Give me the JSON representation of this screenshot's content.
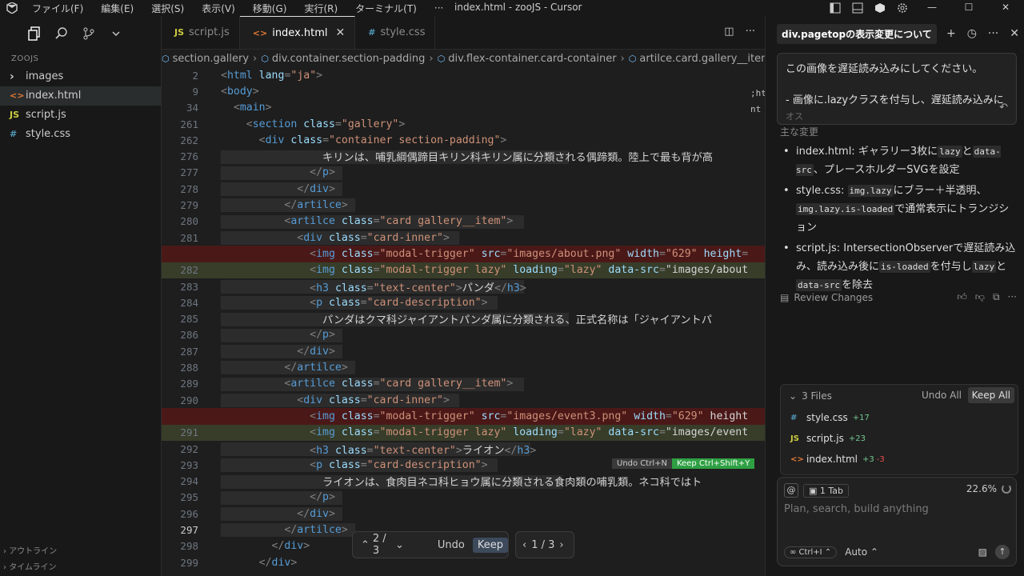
{
  "menu": [
    "ファイル(F)",
    "編集(E)",
    "選択(S)",
    "表示(V)",
    "移動(G)",
    "実行(R)",
    "ターミナル(T)",
    "···"
  ],
  "window_title": "index.html - zooJS - Cursor",
  "window_controls": {
    "minimize": "—",
    "maximize": "☐",
    "close": "✕"
  },
  "explorer": {
    "project": "ZOOJS",
    "items": [
      {
        "icon": "›",
        "label": "images"
      },
      {
        "icon": "<>",
        "label": "index.html"
      },
      {
        "icon": "JS",
        "label": "script.js"
      },
      {
        "icon": "#",
        "label": "style.css"
      }
    ],
    "outline": "アウトライン",
    "timeline": "タイムライン"
  },
  "tabs": [
    {
      "icon": "JS",
      "label": "script.js"
    },
    {
      "icon": "<>",
      "label": "index.html",
      "close": "✕"
    },
    {
      "icon": "#",
      "label": "style.css"
    }
  ],
  "breadcrumb": [
    "section.gallery",
    "div.container.section-padding",
    "div.flex-container.card-container",
    "artilce.card.gallery__item"
  ],
  "code_lines": [
    {
      "n": "2",
      "t": "<html lang=\"ja\">"
    },
    {
      "n": "9",
      "t": "<body>"
    },
    {
      "n": "34",
      "t": "  <main>"
    },
    {
      "n": "261",
      "t": "    <section class=\"gallery\">"
    },
    {
      "n": "262",
      "t": "      <div class=\"container section-padding\">"
    },
    {
      "n": "276",
      "t": "                キリンは、哺乳綱偶蹄目キリン科キリン属に分類される偶蹄類。陸上で最も背が高"
    },
    {
      "n": "277",
      "t": "              </p>"
    },
    {
      "n": "278",
      "t": "            </div>"
    },
    {
      "n": "279",
      "t": "          </artilce>"
    },
    {
      "n": "280",
      "t": "          <artilce class=\"card gallery__item\">"
    },
    {
      "n": "281",
      "t": "            <div class=\"card-inner\">"
    },
    {
      "n": "",
      "t": "              <img class=\"modal-trigger\" src=\"images/about.png\" width=\"629\" height="
    },
    {
      "n": "282",
      "t": "              <img class=\"modal-trigger lazy\" loading=\"lazy\" data-src=\"images/about"
    },
    {
      "n": "283",
      "t": "              <h3 class=\"text-center\">パンダ</h3>"
    },
    {
      "n": "284",
      "t": "              <p class=\"card-description\">"
    },
    {
      "n": "285",
      "t": "                パンダはクマ科ジャイアントパンダ属に分類される、正式名称は「ジャイアントパ"
    },
    {
      "n": "286",
      "t": "              </p>"
    },
    {
      "n": "287",
      "t": "            </div>"
    },
    {
      "n": "288",
      "t": "          </artilce>"
    },
    {
      "n": "289",
      "t": "          <artilce class=\"card gallery__item\">"
    },
    {
      "n": "290",
      "t": "            <div class=\"card-inner\">"
    },
    {
      "n": "",
      "t": "              <img class=\"modal-trigger\" src=\"images/event3.png\" width=\"629\" height"
    },
    {
      "n": "291",
      "t": "              <img class=\"modal-trigger lazy\" loading=\"lazy\" data-src=\"images/event"
    },
    {
      "n": "292",
      "t": "              <h3 class=\"text-center\">ライオン</h3>"
    },
    {
      "n": "293",
      "t": "              <p class=\"card-description\">"
    },
    {
      "n": "294",
      "t": "                ライオンは、食肉目ネコ科ヒョウ属に分類される食肉類の哺乳類。ネコ科ではト"
    },
    {
      "n": "295",
      "t": "              </p>"
    },
    {
      "n": "296",
      "t": "            </div>"
    },
    {
      "n": "297",
      "t": "          </artilce>"
    },
    {
      "n": "298",
      "t": "        </div>"
    },
    {
      "n": "299",
      "t": "      </div>"
    }
  ],
  "minimap_marks": [
    ";ht",
    "nt"
  ],
  "inline_diff": {
    "undo": "Undo Ctrl+N",
    "keep": "Keep Ctrl+Shift+Y"
  },
  "diff_nav": {
    "counter": "2 / 3",
    "undo": "Undo",
    "keep": "Keep",
    "file_counter": "1 / 3"
  },
  "chat": {
    "tab_title": "div.pagetopの表示変更について",
    "prompt_line1": "この画像を遅延読み込みにしてください。",
    "prompt_line2": "- 画像に.lazyクラスを付与し、遅延読み込みに",
    "prompt_line3": "オス",
    "summary_cut": "主な変更",
    "bullets": [
      {
        "pre": "index.html: ギャラリー3枚に",
        "c1": "lazy",
        "mid": "と",
        "c2": "data-src",
        "post": "、プレースホルダーSVGを設定"
      },
      {
        "pre": "style.css: ",
        "c1": "img.lazy",
        "mid": "にブラー＋半透明、",
        "c2": "img.lazy.is-loaded",
        "post": "で通常表示にトランジション"
      },
      {
        "pre": "script.js: IntersectionObserverで遅延読み込み、読み込み後に",
        "c1": "is-loaded",
        "mid": "を付与し",
        "c2": "lazy",
        "post": "と",
        "c3": "data-src",
        "post2": "を除去"
      }
    ],
    "review_changes": "Review Changes",
    "files_header": "3 Files",
    "undo_all": "Undo All",
    "keep_all": "Keep All",
    "files": [
      {
        "icon": "#",
        "name": "style.css",
        "added": "+17",
        "removed": ""
      },
      {
        "icon": "JS",
        "name": "script.js",
        "added": "+23",
        "removed": ""
      },
      {
        "icon": "<>",
        "name": "index.html",
        "added": "+3",
        "removed": "-3"
      }
    ],
    "composer": {
      "at": "@",
      "tab_chip": "1 Tab",
      "context_pct": "22.6%",
      "placeholder": "Plan, search, build anything",
      "mode": "∞ Ctrl+I ⌃",
      "model": "Auto ⌃"
    }
  }
}
